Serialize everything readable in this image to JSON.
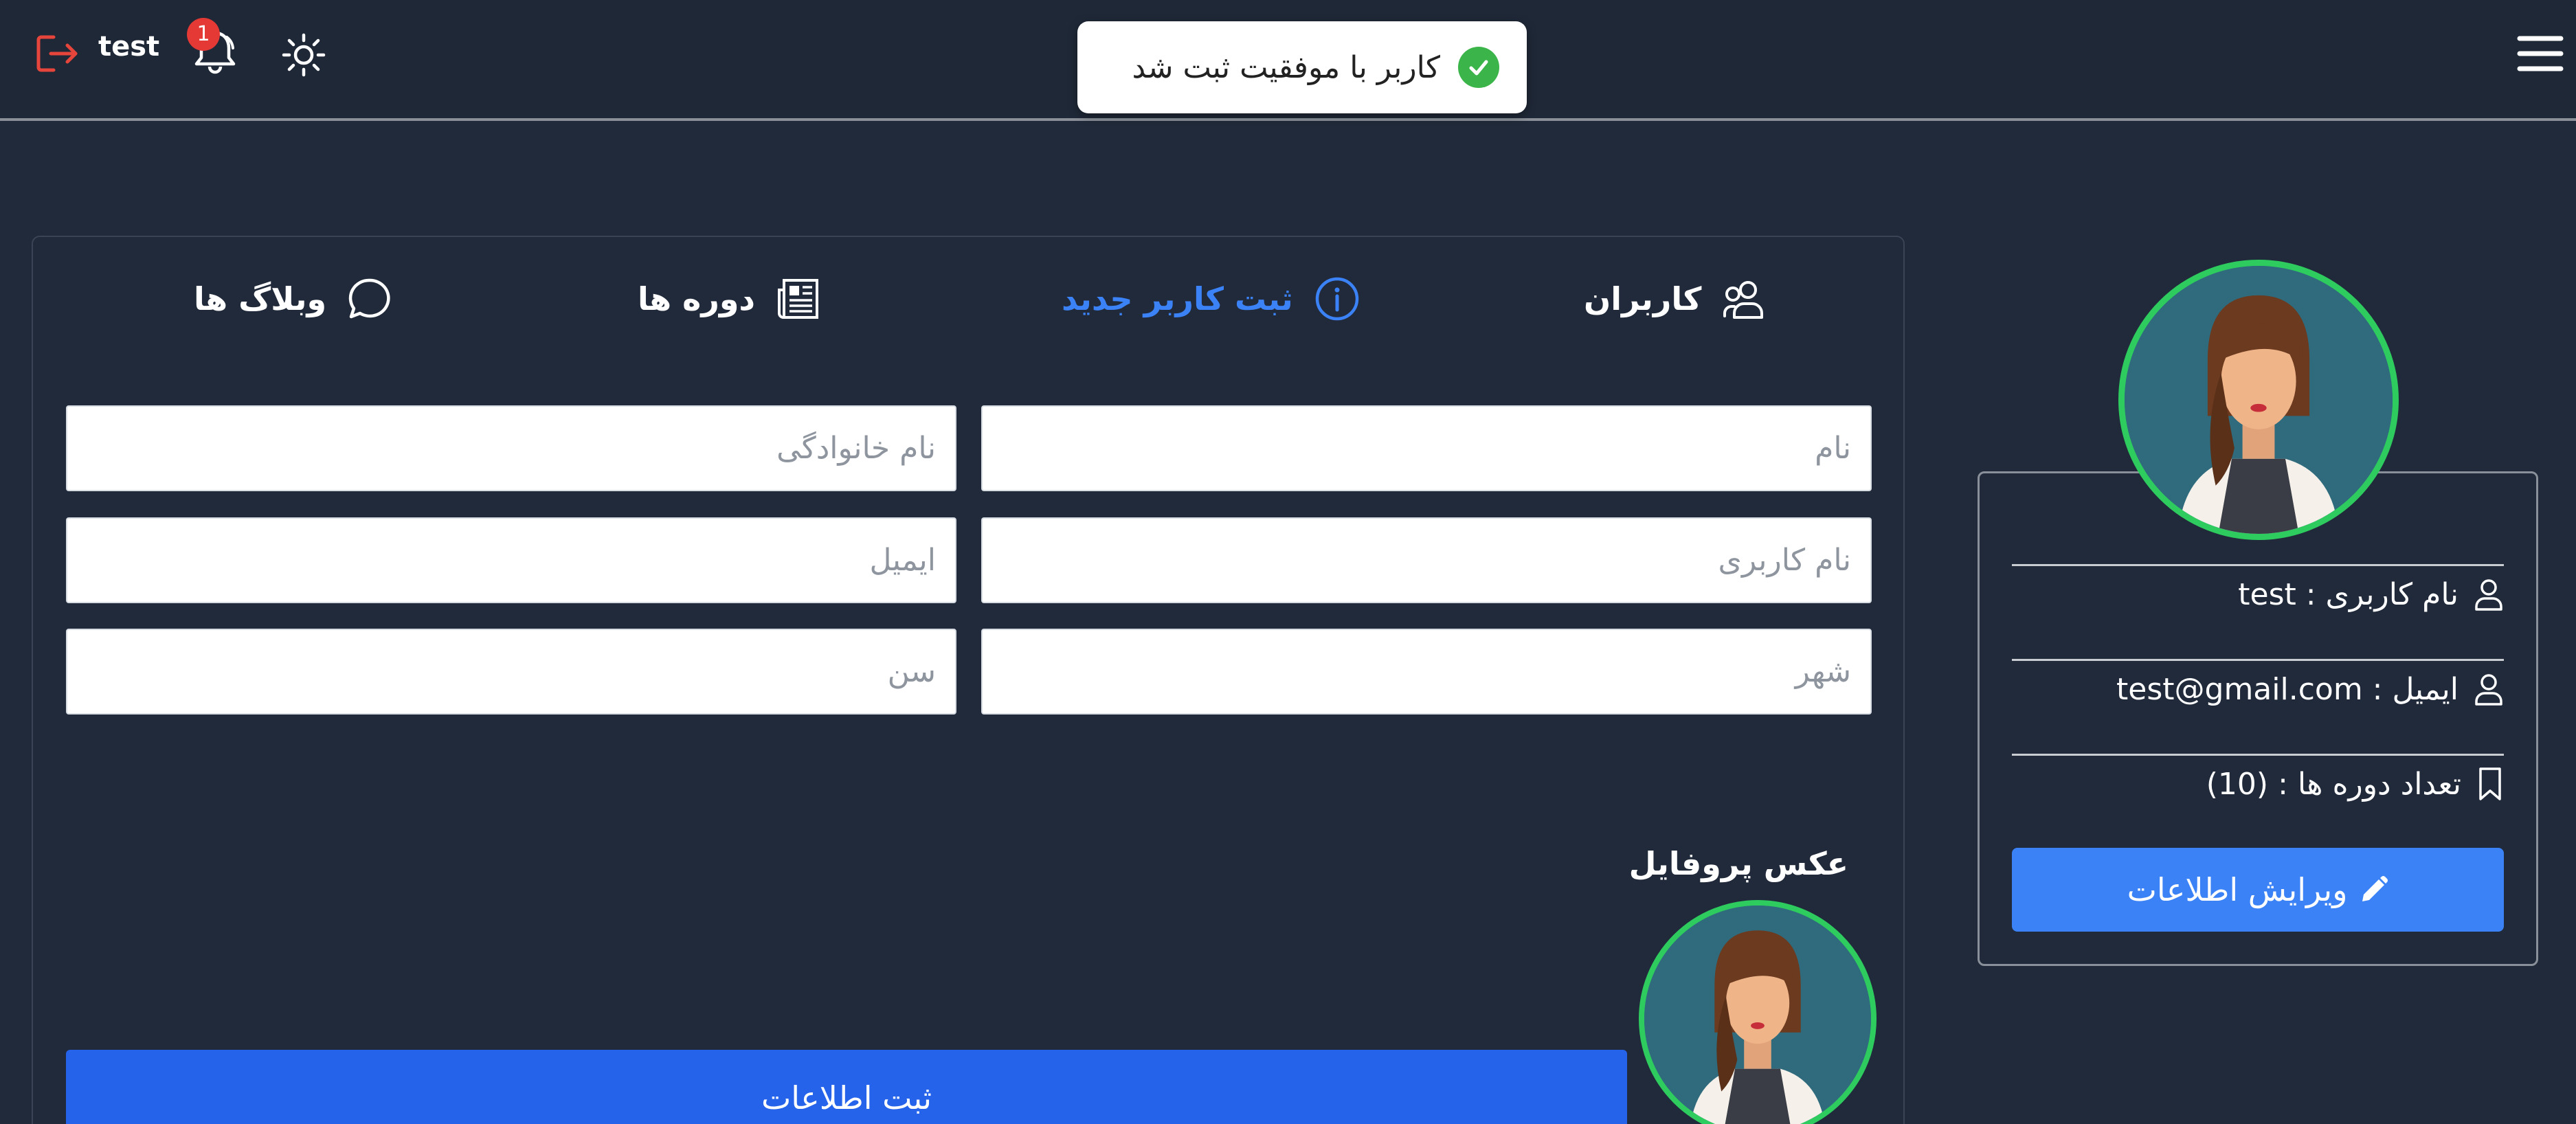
{
  "header": {
    "username": "test",
    "notification_count": "1",
    "icons": [
      "logout-icon",
      "bell-icon",
      "sun-icon",
      "hamburger-menu-icon"
    ]
  },
  "toast": {
    "message": "کاربر با موفقیت ثبت شد",
    "icon": "check-circle-icon"
  },
  "tabs": [
    {
      "label": "کاربران",
      "icon": "users-icon",
      "active": false
    },
    {
      "label": "ثبت کاربر جدید",
      "icon": "info-icon",
      "active": true
    },
    {
      "label": "دوره ها",
      "icon": "newspaper-icon",
      "active": false
    },
    {
      "label": "وبلاگ ها",
      "icon": "chat-bubble-icon",
      "active": false
    }
  ],
  "form": {
    "first_name_placeholder": "نام",
    "last_name_placeholder": "نام خانوادگی",
    "username_placeholder": "نام کاربری",
    "email_placeholder": "ایمیل",
    "city_placeholder": "شهر",
    "age_placeholder": "سن",
    "profile_photo_label": "عکس پروفایل",
    "submit_label": "ثبت اطلاعات"
  },
  "profile": {
    "username_line": "نام کاربری : test",
    "email_line": "ایمیل : test@gmail.com",
    "courses_line": "تعداد دوره ها : (10)",
    "edit_label": "ویرایش اطلاعات"
  },
  "colors": {
    "background": "#212a3a",
    "accent": "#3b82f6",
    "submit": "#2563eb",
    "success": "#3bb54a",
    "avatar_ring": "#2ecc5f",
    "badge": "#e53935",
    "logout": "#e53935"
  }
}
